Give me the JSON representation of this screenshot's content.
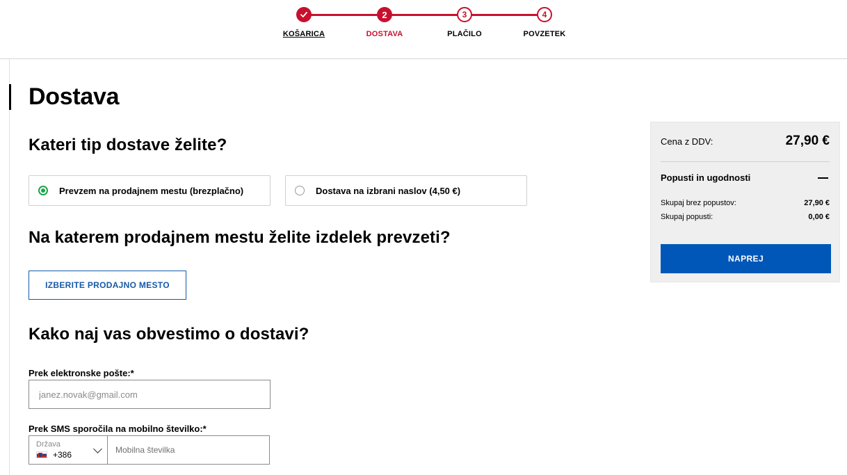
{
  "stepper": {
    "steps": [
      {
        "number": "",
        "label": "KOŠARICA",
        "state": "done",
        "icon": "check-icon"
      },
      {
        "number": "2",
        "label": "DOSTAVA",
        "state": "active"
      },
      {
        "number": "3",
        "label": "PLAČILO",
        "state": "todo"
      },
      {
        "number": "4",
        "label": "POVZETEK",
        "state": "todo"
      }
    ],
    "accent_color": "#c8102e"
  },
  "page": {
    "title": "Dostava"
  },
  "delivery": {
    "question": "Kateri tip dostave želite?",
    "options": [
      {
        "label": "Prevzem na prodajnem mestu (brezplačno)",
        "selected": true
      },
      {
        "label": "Dostava na izbrani naslov (4,50 €)",
        "selected": false
      }
    ]
  },
  "pickup": {
    "question": "Na katerem prodajnem mestu želite izdelek prevzeti?",
    "button_label": "IZBERITE PRODAJNO MESTO"
  },
  "notify": {
    "question": "Kako naj vas obvestimo o dostavi?",
    "email_label": "Prek elektronske pošte:*",
    "email_placeholder": "janez.novak@gmail.com",
    "email_value": "",
    "sms_label": "Prek SMS sporočila na mobilno številko:*",
    "country_caption": "Država",
    "country_code": "+386",
    "country_flag": "slovenia-flag-icon",
    "phone_placeholder": "Mobilna številka",
    "phone_value": ""
  },
  "summary": {
    "price_label": "Cena z DDV:",
    "price_value": "27,90 €",
    "discounts_title": "Popusti in ugodnosti",
    "lines": [
      {
        "label": "Skupaj brez popustov:",
        "value": "27,90 €"
      },
      {
        "label": "Skupaj popusti:",
        "value": "0,00 €"
      }
    ],
    "next_button": "NAPREJ",
    "button_color": "#0057b8"
  }
}
